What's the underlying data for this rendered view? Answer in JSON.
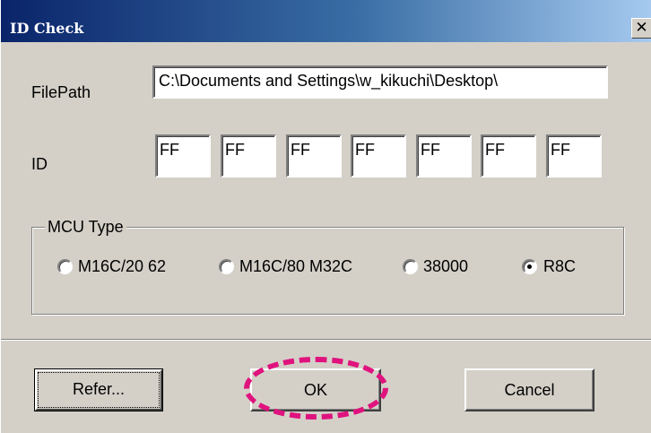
{
  "window": {
    "title": "ID Check",
    "close_label": "×"
  },
  "filepath": {
    "label": "FilePath",
    "value": "C:\\Documents and Settings\\w_kikuchi\\Desktop\\"
  },
  "id": {
    "label": "ID",
    "values": [
      "FF",
      "FF",
      "FF",
      "FF",
      "FF",
      "FF",
      "FF"
    ]
  },
  "mcu_type": {
    "label": "MCU Type",
    "options": [
      {
        "label": "M16C/20 62",
        "selected": false
      },
      {
        "label": "M16C/80  M32C",
        "selected": false
      },
      {
        "label": "38000",
        "selected": false
      },
      {
        "label": "R8C",
        "selected": true
      }
    ]
  },
  "buttons": {
    "refer_label": "Refer...",
    "ok_label": "OK",
    "cancel_label": "Cancel"
  },
  "colors": {
    "title_start": "#0a246a",
    "title_end": "#a6caf0",
    "face": "#d4d0c8",
    "highlight": "#e0137e"
  }
}
